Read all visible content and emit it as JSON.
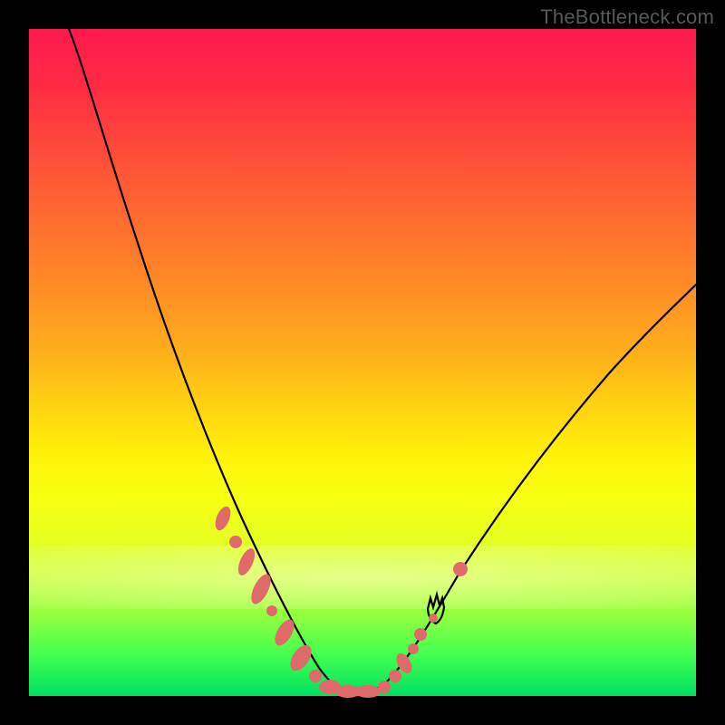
{
  "watermark": "TheBottleneck.com",
  "colors": {
    "frame": "#000000",
    "dot": "#e06a6a",
    "curve": "#000000"
  },
  "chart_data": {
    "type": "line",
    "title": "",
    "xlabel": "",
    "ylabel": "",
    "xlim": [
      0,
      100
    ],
    "ylim": [
      0,
      100
    ],
    "grid": false,
    "legend": false,
    "series": [
      {
        "name": "bottleneck-curve",
        "x": [
          6,
          10,
          14,
          18,
          22,
          26,
          30,
          34,
          37,
          40,
          42,
          44,
          46,
          48,
          50,
          54,
          58,
          64,
          72,
          82,
          94,
          100
        ],
        "y": [
          100,
          90,
          80,
          70,
          60,
          50,
          40,
          28,
          18,
          10,
          5,
          2,
          1,
          1,
          2,
          6,
          12,
          20,
          30,
          42,
          55,
          62
        ]
      }
    ],
    "highlight_points": {
      "name": "sample-dots",
      "x": [
        28,
        30,
        32,
        34,
        36,
        38,
        40,
        42,
        44,
        46,
        48,
        50,
        52,
        54,
        56,
        58
      ],
      "y": [
        30,
        25,
        20,
        15,
        10,
        6,
        3,
        1,
        1,
        1,
        2,
        3,
        6,
        9,
        13,
        18
      ]
    }
  }
}
